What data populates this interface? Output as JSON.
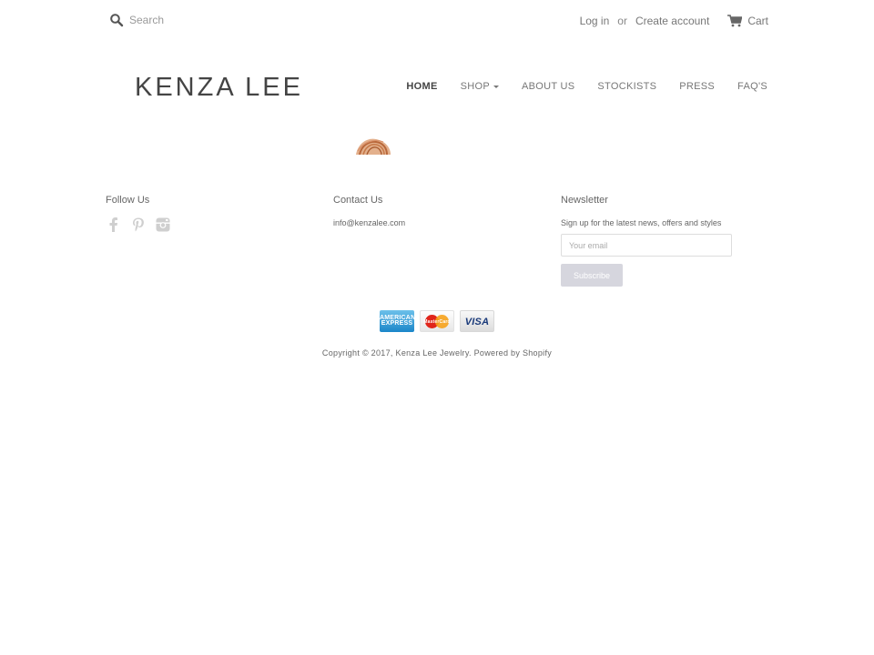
{
  "top_bar": {
    "search_placeholder": "Search",
    "login": "Log in",
    "or": "or",
    "create_account": "Create account",
    "cart": "Cart"
  },
  "header": {
    "logo": "KENZA LEE",
    "nav": [
      {
        "label": "HOME",
        "active": true
      },
      {
        "label": "SHOP",
        "dropdown": true
      },
      {
        "label": "ABOUT US"
      },
      {
        "label": "STOCKISTS"
      },
      {
        "label": "PRESS"
      },
      {
        "label": "FAQ'S"
      }
    ]
  },
  "footer": {
    "follow": {
      "title": "Follow Us",
      "icons": [
        "facebook-icon",
        "pinterest-icon",
        "instagram-icon"
      ]
    },
    "contact": {
      "title": "Contact Us",
      "email": "info@kenzalee.com"
    },
    "newsletter": {
      "title": "Newsletter",
      "description": "Sign up for the latest news, offers and styles",
      "email_placeholder": "Your email",
      "subscribe_label": "Subscribe"
    },
    "payments": [
      "american-express-icon",
      "mastercard-icon",
      "visa-icon"
    ],
    "payment_labels": {
      "amex": "AMERICAN EXPRESS",
      "mastercard": "MasterCard",
      "visa": "VISA"
    },
    "copyright_prefix": "Copyright © 2017,",
    "copyright_brand": "Kenza Lee Jewelry",
    "powered": "Powered by Shopify"
  },
  "colors": {
    "text": "#555555",
    "subscribe_bg": "#d6d6de",
    "amex": "#1b86c9",
    "visa_text": "#1a3a7a"
  }
}
